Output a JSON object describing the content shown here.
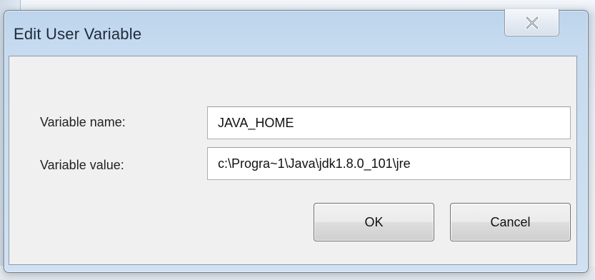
{
  "dialog": {
    "title": "Edit User Variable",
    "close_icon": "close-x-icon"
  },
  "form": {
    "name_label": "Variable name:",
    "name_value": "JAVA_HOME",
    "value_label": "Variable value:",
    "value_value": "c:\\Progra~1\\Java\\jdk1.8.0_101\\jre"
  },
  "buttons": {
    "ok_label": "OK",
    "cancel_label": "Cancel"
  },
  "colors": {
    "frame": "#c6dbef",
    "client": "#f0f0f0",
    "button_border": "#707070"
  }
}
